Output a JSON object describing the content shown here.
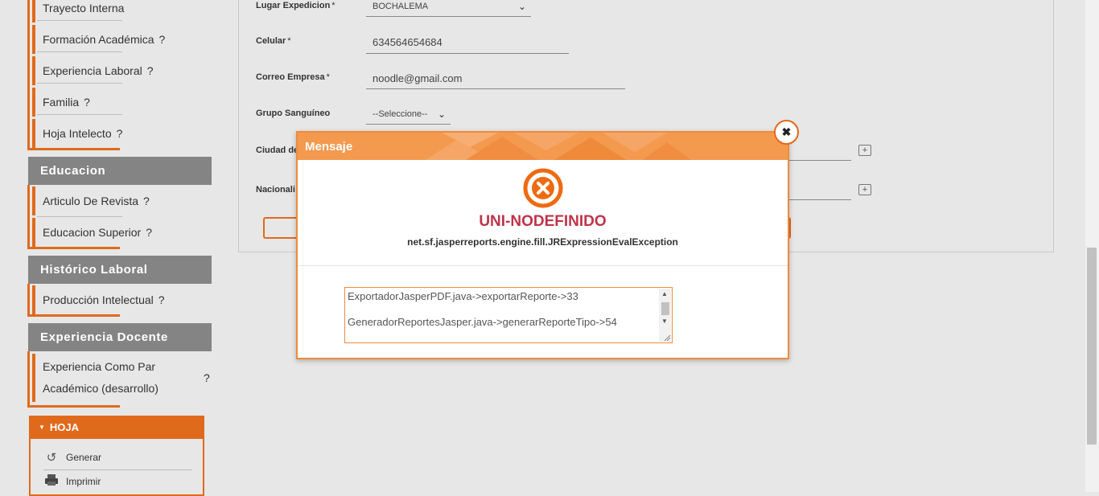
{
  "sidebar": {
    "top_items": [
      {
        "label": "Trayecto Interna",
        "help": ""
      },
      {
        "label": "Formación Académica",
        "help": "?"
      },
      {
        "label": "Experiencia Laboral",
        "help": "?"
      },
      {
        "label": "Familia",
        "help": "?"
      },
      {
        "label": "Hoja Intelecto",
        "help": "?"
      }
    ],
    "sections": [
      {
        "title": "Educacion",
        "items": [
          {
            "label": "Articulo De Revista",
            "help": "?"
          },
          {
            "label": "Educacion Superior",
            "help": "?"
          }
        ]
      },
      {
        "title": "Histórico Laboral",
        "items": [
          {
            "label": "Producción Intelectual",
            "help": "?"
          }
        ]
      },
      {
        "title": "Experiencia Docente",
        "items": [
          {
            "label_line1": "Experiencia Como Par",
            "label_line2": "Académico (desarrollo)",
            "help": "?"
          }
        ]
      }
    ],
    "hoja": {
      "title": "HOJA",
      "items": [
        {
          "label": "Generar",
          "icon": "history-icon"
        },
        {
          "label": "Imprimir",
          "icon": "printer-icon"
        }
      ]
    }
  },
  "form": {
    "lugar_expedicion": {
      "label": "Lugar Expedicion",
      "required": "*",
      "value": "BOCHALEMA"
    },
    "celular": {
      "label": "Celular",
      "required": "*",
      "value": "634564654684"
    },
    "correo_empresa": {
      "label": "Correo Empresa",
      "required": "*",
      "value": "noodle@gmail.com"
    },
    "grupo_sanguineo": {
      "label": "Grupo Sanguíneo",
      "value": "--Seleccione--"
    },
    "ciudad": {
      "label": "Ciudad de"
    },
    "nacionalidad": {
      "label": "Nacionali"
    }
  },
  "modal": {
    "title": "Mensaje",
    "close_symbol": "✖",
    "error_title": "UNI-NODEFINIDO",
    "error_class": "net.sf.jasperreports.engine.fill.JRExpressionEvalException",
    "trace": [
      "ExportadorJasperPDF.java->exportarReporte->33",
      "GeneradorReportesJasper.java->generarReporteTipo->54"
    ]
  },
  "colors": {
    "accent": "#e06a1c",
    "modal_header": "#f39a4e",
    "error_title": "#c0334a",
    "section_header": "#848484"
  }
}
